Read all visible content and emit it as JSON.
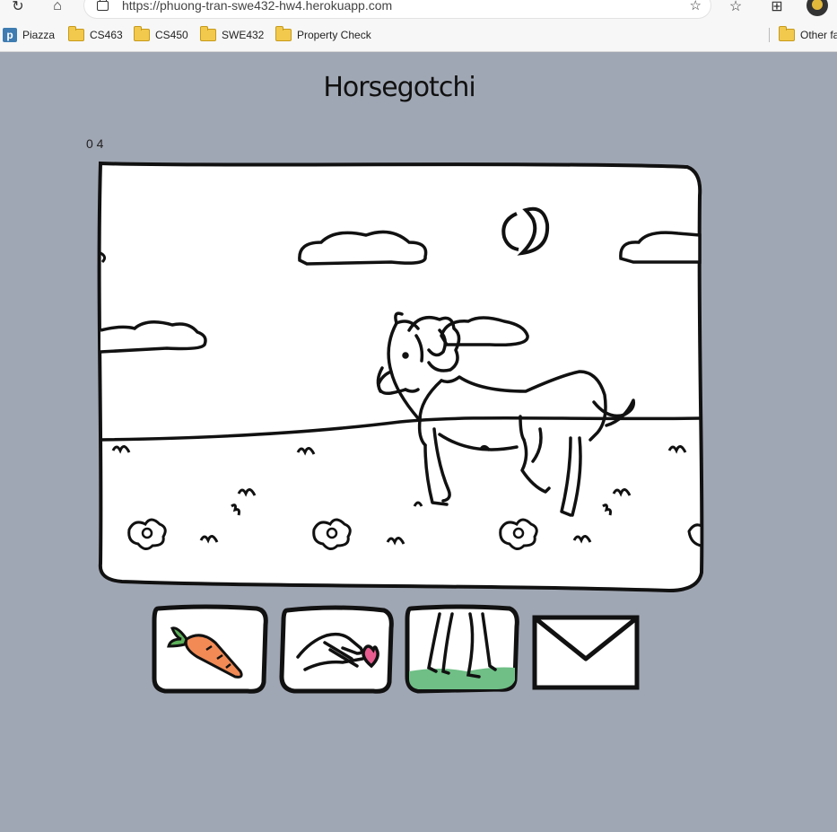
{
  "browser": {
    "url": "https://phuong-tran-swe432-hw4.herokuapp.com",
    "bookmarks": [
      "Piazza",
      "CS463",
      "CS450",
      "SWE432",
      "Property Check"
    ],
    "other_favorites": "Other fa"
  },
  "page": {
    "title": "Horsegotchi",
    "counter": "0 4"
  },
  "actions": [
    {
      "name": "feed",
      "icon": "carrot-icon"
    },
    {
      "name": "pet",
      "icon": "hand-heart-icon"
    },
    {
      "name": "walk",
      "icon": "walking-legs-icon"
    },
    {
      "name": "mail",
      "icon": "envelope-icon"
    }
  ],
  "colors": {
    "background": "#a0a7b4",
    "carrot": "#f28a55",
    "carrot_leaf": "#5cb15a",
    "heart": "#e85c8f",
    "grass": "#6fbf86"
  }
}
